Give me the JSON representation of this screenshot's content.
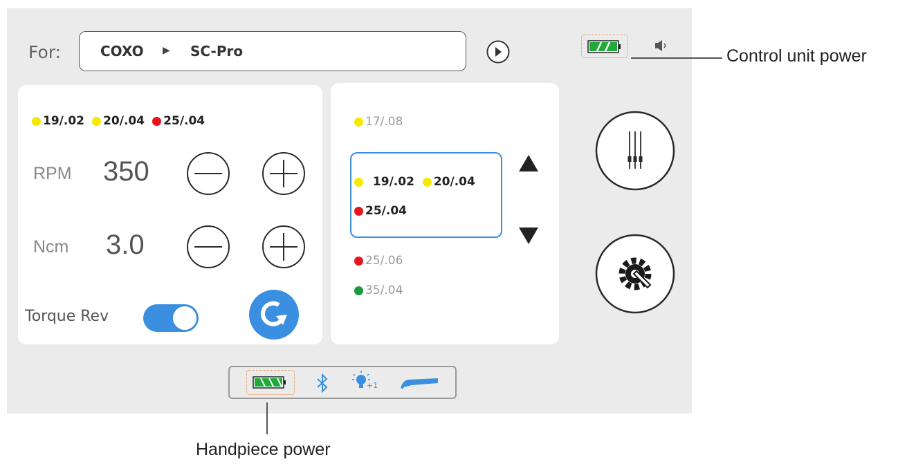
{
  "header": {
    "for_label": "For:",
    "brand": "COXO",
    "separator": "▶",
    "model": "SC-Pro"
  },
  "left_panel": {
    "file_tags": [
      {
        "label": "19/.02",
        "color": "#f5e900"
      },
      {
        "label": "20/.04",
        "color": "#f5e900"
      },
      {
        "label": "25/.04",
        "color": "#e8141b"
      }
    ],
    "rpm_label": "RPM",
    "rpm_value": "350",
    "ncm_label": "Ncm",
    "ncm_value": "3.0",
    "torque_rev_label": "Torque Rev",
    "torque_rev_enabled": true
  },
  "file_list": {
    "above": {
      "label": "17/.08",
      "color": "#f5e900"
    },
    "selected": [
      {
        "label": "19/.02",
        "color": "#f5e900"
      },
      {
        "label": "20/.04",
        "color": "#f5e900"
      },
      {
        "label": "25/.04",
        "color": "#e8141b"
      }
    ],
    "below": [
      {
        "label": "25/.06",
        "color": "#e8141b"
      },
      {
        "label": "35/.04",
        "color": "#1a9b3c"
      }
    ]
  },
  "icons": {
    "play": "circle-arrow-icon",
    "battery": "battery-icon",
    "speaker": "speaker-icon",
    "files": "endo-files-icon",
    "settings": "gear-wrench-icon",
    "rotation": "rotation-icon",
    "bluetooth": "bluetooth-icon",
    "light": "light-bulb-icon",
    "handpiece": "handpiece-icon"
  },
  "status_bar": {
    "light_level": "+1"
  },
  "callouts": {
    "control_unit_power": "Control unit power",
    "handpiece_power": "Handpiece power"
  },
  "colors": {
    "accent_blue": "#3b8fe0",
    "battery_green": "#1faa3a",
    "battery_frame": "#f0a060"
  }
}
